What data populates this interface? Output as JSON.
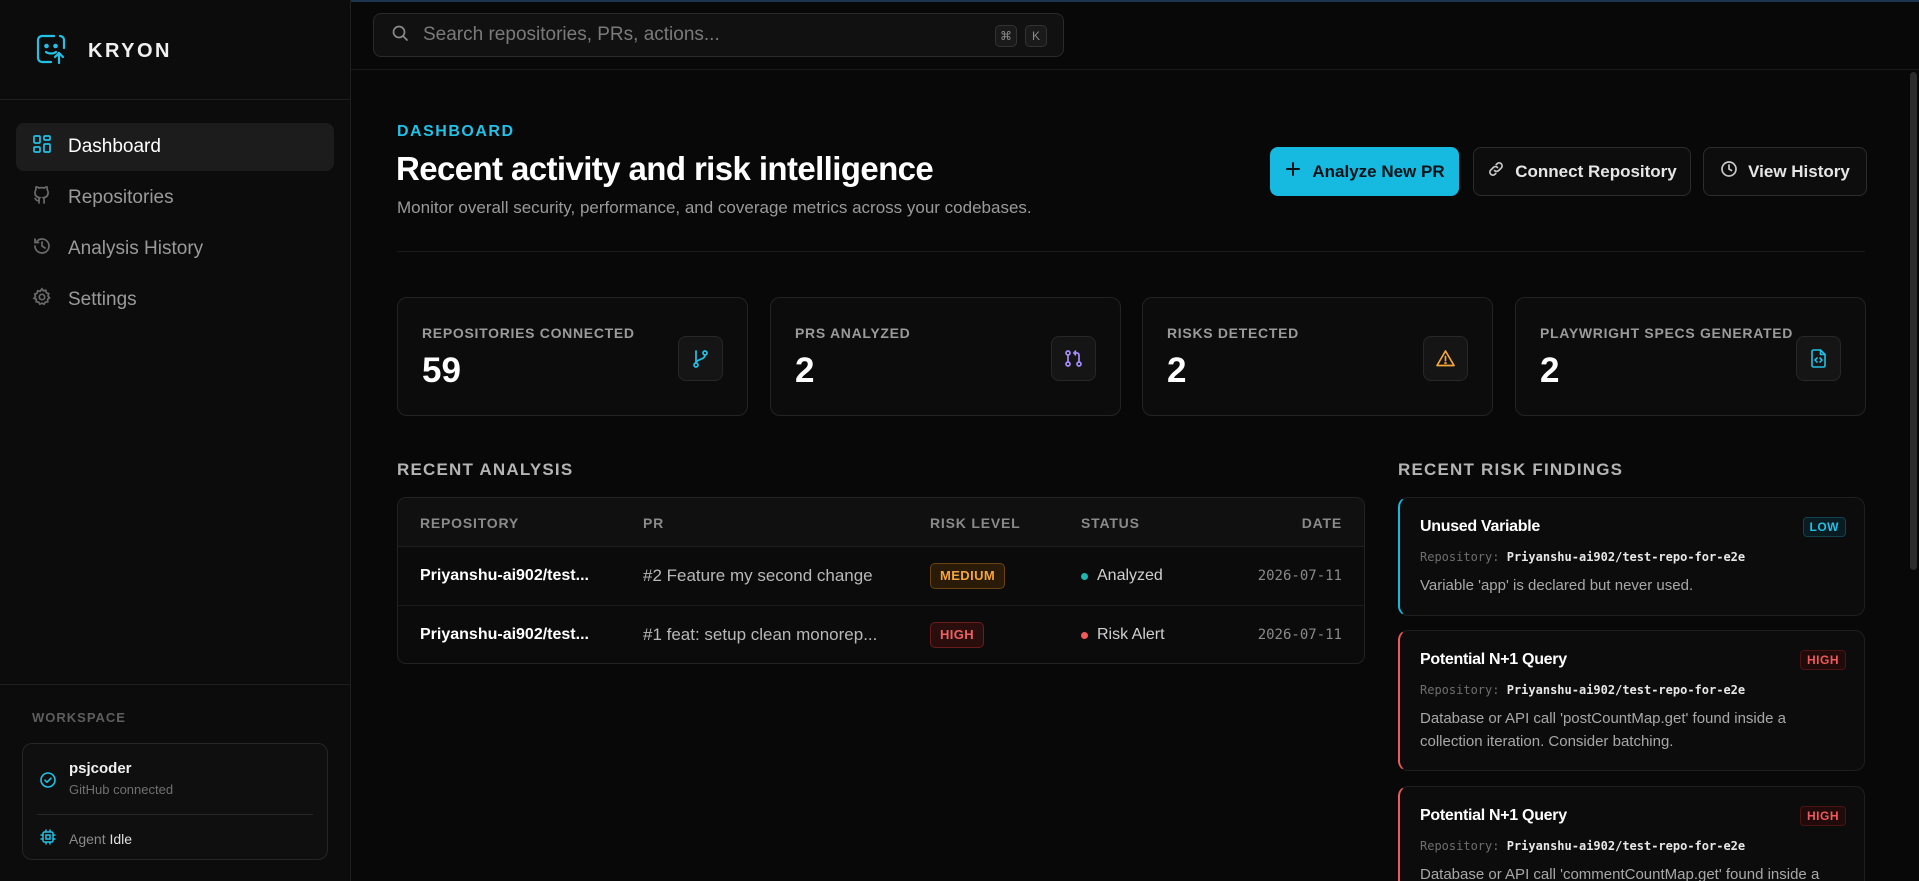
{
  "app": {
    "name": "KRYON"
  },
  "search": {
    "placeholder": "Search repositories, PRs, actions...",
    "shortcut": [
      "⌘",
      "K"
    ]
  },
  "sidebar": {
    "items": [
      {
        "label": "Dashboard",
        "icon": "dashboard-icon",
        "active": true
      },
      {
        "label": "Repositories",
        "icon": "repository-icon"
      },
      {
        "label": "Analysis History",
        "icon": "history-icon"
      },
      {
        "label": "Settings",
        "icon": "gear-icon"
      }
    ],
    "workspace": {
      "label": "WORKSPACE",
      "user": "psjcoder",
      "status": "GitHub connected",
      "agent_label": "Agent",
      "agent_state": "Idle"
    }
  },
  "header": {
    "eyebrow": "DASHBOARD",
    "title": "Recent activity and risk intelligence",
    "subtitle": "Monitor overall security, performance, and coverage metrics across your codebases.",
    "actions": {
      "analyze": "Analyze New PR",
      "connect": "Connect Repository",
      "history": "View History"
    }
  },
  "stats": [
    {
      "label": "REPOSITORIES CONNECTED",
      "value": "59",
      "icon": "branch-icon"
    },
    {
      "label": "PRS ANALYZED",
      "value": "2",
      "icon": "pull-request-icon"
    },
    {
      "label": "RISKS DETECTED",
      "value": "2",
      "icon": "warning-icon"
    },
    {
      "label": "PLAYWRIGHT SPECS GENERATED",
      "value": "2",
      "icon": "code-file-icon"
    }
  ],
  "recent_analysis": {
    "title": "RECENT ANALYSIS",
    "columns": [
      "REPOSITORY",
      "PR",
      "RISK LEVEL",
      "STATUS",
      "DATE"
    ],
    "rows": [
      {
        "repo": "Priyanshu-ai902/test...",
        "pr": "#2 Feature my second change",
        "risk": "MEDIUM",
        "status": "Analyzed",
        "date": "2026-07-11"
      },
      {
        "repo": "Priyanshu-ai902/test...",
        "pr": "#1 feat: setup clean monorep...",
        "risk": "HIGH",
        "status": "Risk Alert",
        "date": "2026-07-11"
      }
    ]
  },
  "risk_findings": {
    "title": "RECENT RISK FINDINGS",
    "repo_label": "Repository:",
    "items": [
      {
        "title": "Unused Variable",
        "severity": "LOW",
        "repo": "Priyanshu-ai902/test-repo-for-e2e",
        "desc": "Variable 'app' is declared but never used."
      },
      {
        "title": "Potential N+1 Query",
        "severity": "HIGH",
        "repo": "Priyanshu-ai902/test-repo-for-e2e",
        "desc": "Database or API call 'postCountMap.get' found inside a collection iteration. Consider batching."
      },
      {
        "title": "Potential N+1 Query",
        "severity": "HIGH",
        "repo": "Priyanshu-ai902/test-repo-for-e2e",
        "desc": "Database or API call 'commentCountMap.get' found inside a"
      }
    ]
  },
  "colors": {
    "accent": "#16b9e0",
    "medium": "#f4a63a",
    "high": "#f05a5a",
    "analyzed_dot": "#1fb7b0",
    "alert_dot": "#f05a5a"
  }
}
